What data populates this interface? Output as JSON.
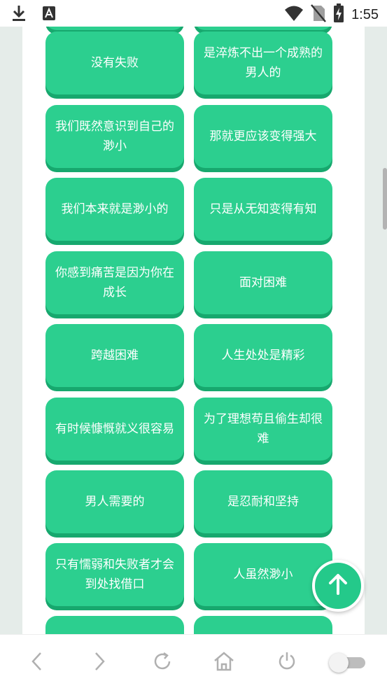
{
  "status_bar": {
    "time": "1:55",
    "left_icons": [
      "download-icon",
      "font-app-icon"
    ],
    "right_icons": [
      "wifi-icon",
      "no-sim-icon",
      "battery-charging-icon"
    ]
  },
  "cards": [
    {
      "text": ""
    },
    {
      "text": ""
    },
    {
      "text": "没有失败"
    },
    {
      "text": "是淬炼不出一个成熟的男人的"
    },
    {
      "text": "我们既然意识到自己的渺小"
    },
    {
      "text": "那就更应该变得强大"
    },
    {
      "text": "我们本来就是渺小的"
    },
    {
      "text": "只是从无知变得有知"
    },
    {
      "text": "你感到痛苦是因为你在成长"
    },
    {
      "text": "面对困难"
    },
    {
      "text": "跨越困难"
    },
    {
      "text": "人生处处是精彩"
    },
    {
      "text": "有时候慷慨就义很容易"
    },
    {
      "text": "为了理想苟且偷生却很难"
    },
    {
      "text": "男人需要的"
    },
    {
      "text": "是忍耐和坚持"
    },
    {
      "text": "只有懦弱和失败者才会到处找借口"
    },
    {
      "text": "人虽然渺小"
    },
    {
      "text": ""
    },
    {
      "text": ""
    }
  ],
  "fab": {
    "icon": "arrow-up-icon"
  },
  "bottom_nav": {
    "items": [
      "back-icon",
      "forward-icon",
      "refresh-icon",
      "home-icon",
      "power-icon"
    ],
    "toggle_on": false
  },
  "colors": {
    "card": "#2ccf8f",
    "card_shadow": "#17a86e",
    "background": "#e5ece9"
  }
}
